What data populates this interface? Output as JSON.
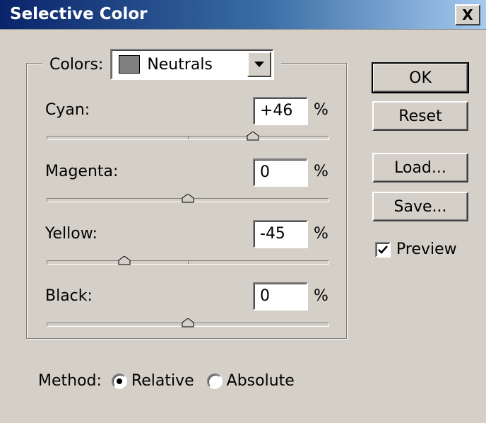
{
  "window": {
    "title": "Selective Color",
    "close_glyph": "X"
  },
  "colors": {
    "label": "Colors:",
    "selected": "Neutrals",
    "swatch_color": "#808080"
  },
  "sliders": [
    {
      "name": "Cyan:",
      "value": "+46",
      "unit": "%",
      "position_percent": 73
    },
    {
      "name": "Magenta:",
      "value": "0",
      "unit": "%",
      "position_percent": 50
    },
    {
      "name": "Yellow:",
      "value": "-45",
      "unit": "%",
      "position_percent": 27.5
    },
    {
      "name": "Black:",
      "value": "0",
      "unit": "%",
      "position_percent": 50
    }
  ],
  "buttons": {
    "ok": "OK",
    "reset": "Reset",
    "load": "Load...",
    "save": "Save..."
  },
  "preview": {
    "label": "Preview",
    "checked": true
  },
  "method": {
    "label": "Method:",
    "options": [
      {
        "label": "Relative",
        "selected": true
      },
      {
        "label": "Absolute",
        "selected": false
      }
    ]
  }
}
